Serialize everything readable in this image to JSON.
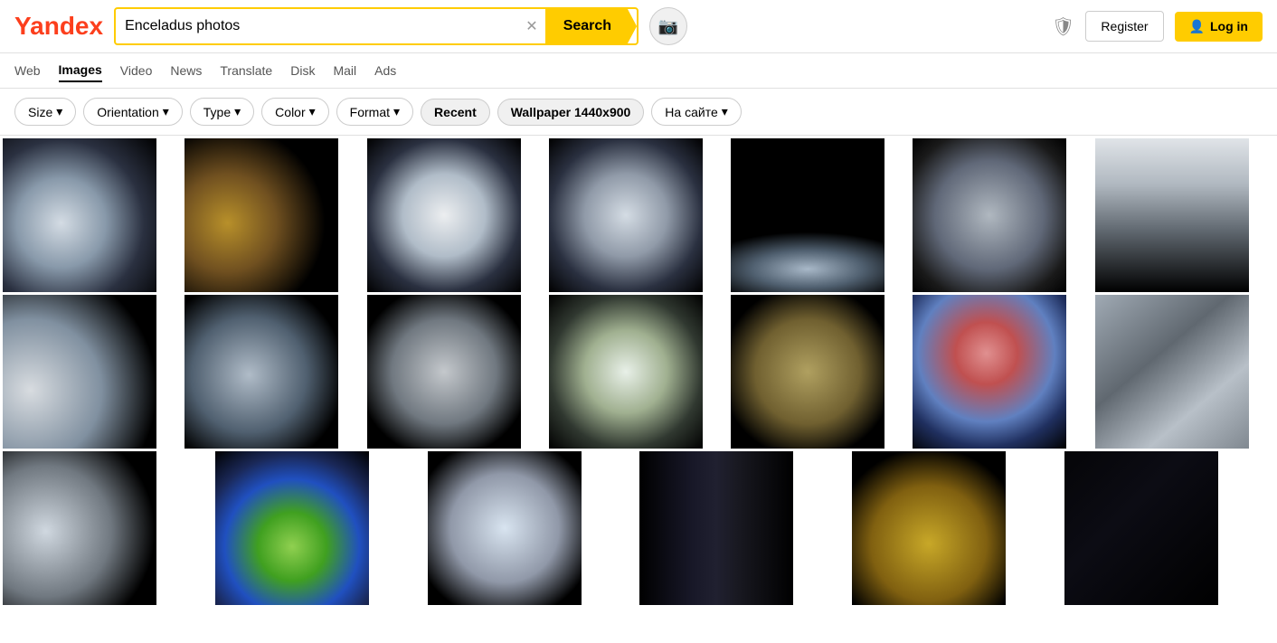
{
  "logo": {
    "text_y": "Y",
    "text_andex": "andex"
  },
  "search": {
    "query": "Enceladus photos",
    "placeholder": "Search",
    "button_label": "Search",
    "clear_icon": "✕"
  },
  "header": {
    "camera_icon": "📷",
    "shield_icon": "🛡",
    "register_label": "Register",
    "login_icon": "👤",
    "login_label": "Log in"
  },
  "nav": {
    "items": [
      {
        "label": "Web",
        "active": false
      },
      {
        "label": "Images",
        "active": true
      },
      {
        "label": "Video",
        "active": false
      },
      {
        "label": "News",
        "active": false
      },
      {
        "label": "Translate",
        "active": false
      },
      {
        "label": "Disk",
        "active": false
      },
      {
        "label": "Mail",
        "active": false
      },
      {
        "label": "Ads",
        "active": false
      }
    ]
  },
  "filters": {
    "items": [
      {
        "label": "Size",
        "has_arrow": true
      },
      {
        "label": "Orientation",
        "has_arrow": true
      },
      {
        "label": "Type",
        "has_arrow": true
      },
      {
        "label": "Color",
        "has_arrow": true
      },
      {
        "label": "Format",
        "has_arrow": true
      },
      {
        "label": "Recent",
        "has_arrow": false
      },
      {
        "label": "Wallpaper 1440x900",
        "has_arrow": false
      },
      {
        "label": "На сайте",
        "has_arrow": true
      }
    ]
  },
  "images": {
    "row1": [
      {
        "id": "r1c1",
        "bg": "radial-gradient(circle at 40% 50%, #c8d0d8 0%, #8899aa 40%, #1a1a2e 70%, #000 100%)",
        "desc": "Enceladus moon white"
      },
      {
        "id": "r1c2",
        "bg": "radial-gradient(circle at 30% 50%, #c8a020 0%, #805010 40%, #000 70%)",
        "desc": "Enceladus crescent gold"
      },
      {
        "id": "r1c3",
        "bg": "radial-gradient(circle at 50% 50%, #e8ecf0 0%, #b0bcc8 40%, #000 80%)",
        "desc": "Enceladus full white"
      },
      {
        "id": "r1c4",
        "bg": "radial-gradient(circle at 50% 50%, #d0d8e0 0%, #909aa8 40%, #000 80%)",
        "desc": "Enceladus grey"
      },
      {
        "id": "r1c5",
        "bg": "radial-gradient(ellipse at 50% 70%, #a8b8c8 0%, #4060 80 40%, #000 80%)",
        "desc": "Enceladus arc dark"
      },
      {
        "id": "r1c6",
        "bg": "radial-gradient(circle at 50% 50%, #b0b8c0 0%, #606878 50%, #000 90%)",
        "desc": "Enceladus dim"
      },
      {
        "id": "r1c7",
        "bg": "linear-gradient(to bottom, #fff 0%, #d0d0d0 50%, #000 100%)",
        "desc": "Enceladus tall"
      }
    ],
    "row2": [
      {
        "id": "r2c1",
        "bg": "radial-gradient(circle at 20% 60%, #e0e4e8 0%, #8090a0 50%, #000 80%)",
        "desc": "Enceladus left"
      },
      {
        "id": "r2c2",
        "bg": "radial-gradient(circle at 40% 50%, #b0bcc8 0%, #506070 50%, #000 80%)",
        "desc": "Enceladus dark"
      },
      {
        "id": "r2c3",
        "bg": "radial-gradient(circle at 50% 50%, #c0c4c8 0%, #707880 50%, #000 80%)",
        "desc": "Enceladus grey2"
      },
      {
        "id": "r2c4",
        "bg": "radial-gradient(circle at 50% 50%, #e8f0e8 0%, #a0b8a0 40%, #000 80%)",
        "desc": "Enceladus green tint"
      },
      {
        "id": "r2c5",
        "bg": "radial-gradient(circle at 50% 50%, #a09060 0%, #605030 50%, #000 80%)",
        "desc": "Enceladus brown"
      },
      {
        "id": "r2c6",
        "bg": "radial-gradient(circle at 50% 40%, #e08080 0%, #c04040 30%, #4060a0 60%, #000 90%)",
        "desc": "Enceladus colorful"
      },
      {
        "id": "r2c7",
        "bg": "linear-gradient(135deg, #a0a8b0 0%, #606870 50%, #c0c8d0 100%)",
        "desc": "Enceladus lines"
      }
    ],
    "row3": [
      {
        "id": "r3c1",
        "bg": "radial-gradient(circle at 30% 50%, #d0d8e0 0%, #707880 50%, #000 80%)",
        "desc": "Enceladus left2"
      },
      {
        "id": "r3c2",
        "bg": "radial-gradient(circle at 50% 60%, #80c040 0%, #40a020 30%, #2040c0 60%, #000 90%)",
        "desc": "Enceladus colorful2"
      },
      {
        "id": "r3c3",
        "bg": "radial-gradient(circle at 50% 50%, #e0e8f0 0%, #606870 60%, #000 90%)",
        "desc": "Enceladus crescent2"
      },
      {
        "id": "r3c4",
        "bg": "linear-gradient(to right, #000 0%, #101018 30%, #202838 50%, #181820 70%, #000 100%)",
        "desc": "Enceladus dark spectrum"
      },
      {
        "id": "r3c5",
        "bg": "radial-gradient(circle at 50% 60%, #c8a020 0%, #806010 50%, #000 80%)",
        "desc": "Enceladus gold"
      },
      {
        "id": "r3c6",
        "bg": "linear-gradient(to bottom right, #000 0%, #0a0a14 50%, #000 100%)",
        "desc": "Enceladus dark2"
      }
    ]
  }
}
